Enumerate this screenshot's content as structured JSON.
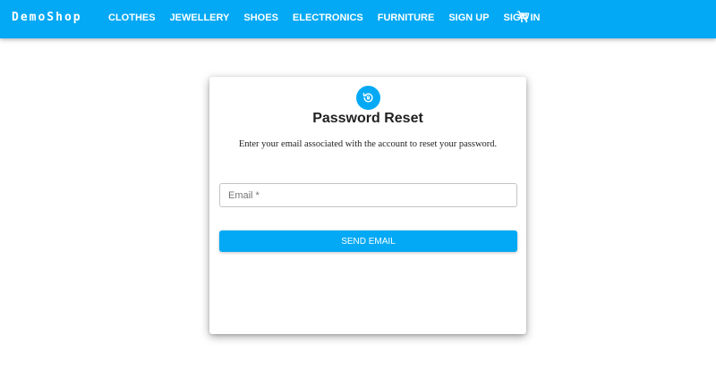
{
  "navbar": {
    "brand": "DemoShop",
    "items": [
      {
        "label": "CLOTHES"
      },
      {
        "label": "JEWELLERY"
      },
      {
        "label": "SHOES"
      },
      {
        "label": "ELECTRONICS"
      },
      {
        "label": "FURNITURE"
      },
      {
        "label": "SIGN UP"
      },
      {
        "label": "SIGN IN"
      }
    ],
    "cart_icon": "cart-icon",
    "background_color": "#03a9f4"
  },
  "reset_card": {
    "avatar_icon": "lock-reset-icon",
    "title": "Password Reset",
    "description": "Enter your email associated with the account to reset your password.",
    "email_field": {
      "placeholder": "Email *",
      "value": ""
    },
    "send_button_label": "SEND EMAIL"
  },
  "colors": {
    "accent": "#03a9f4",
    "text": "#222222",
    "input_border": "#c4c4c4"
  }
}
